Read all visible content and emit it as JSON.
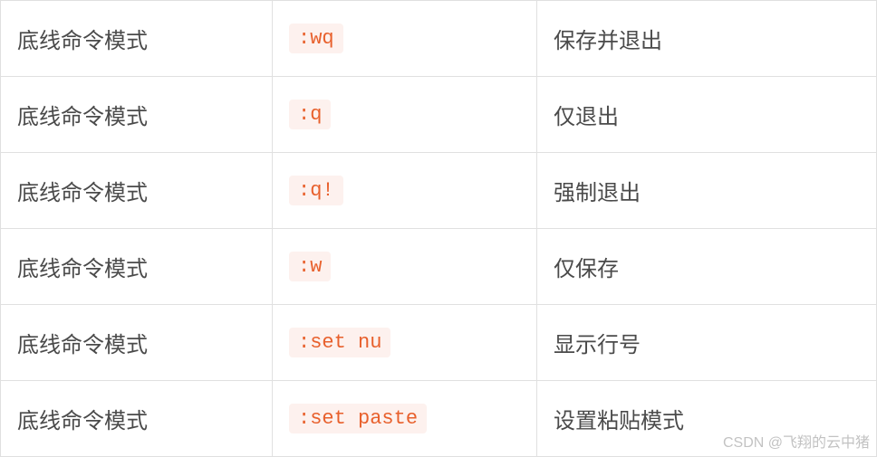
{
  "rows": [
    {
      "mode": "底线命令模式",
      "command": ":wq",
      "description": "保存并退出"
    },
    {
      "mode": "底线命令模式",
      "command": ":q",
      "description": "仅退出"
    },
    {
      "mode": "底线命令模式",
      "command": ":q!",
      "description": "强制退出"
    },
    {
      "mode": "底线命令模式",
      "command": ":w",
      "description": "仅保存"
    },
    {
      "mode": "底线命令模式",
      "command": ":set nu",
      "description": "显示行号"
    },
    {
      "mode": "底线命令模式",
      "command": ":set paste",
      "description": "设置粘贴模式"
    }
  ],
  "watermark": "CSDN @飞翔的云中猪"
}
